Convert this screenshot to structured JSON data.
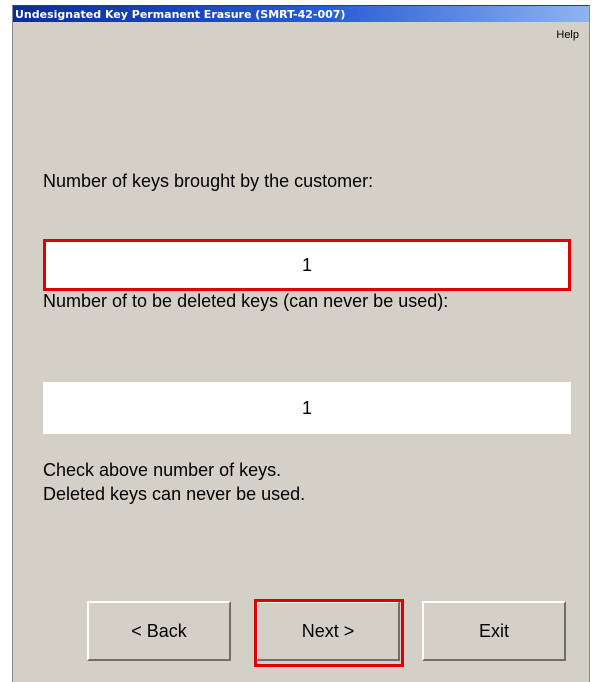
{
  "window": {
    "title": "Undesignated Key Permanent Erasure (SMRT-42-007)"
  },
  "menu": {
    "help_label": "Help"
  },
  "form": {
    "keys_brought_label": "Number of keys brought by the customer:",
    "keys_brought_value": "1",
    "keys_deleted_label": "Number of to be deleted keys (can never be used):",
    "keys_deleted_value": "1",
    "check_line_1": "Check above number of keys.",
    "check_line_2": "Deleted keys can never be used."
  },
  "buttons": {
    "back_label": "< Back",
    "next_label": "Next >",
    "exit_label": "Exit"
  },
  "colors": {
    "highlight": "#e10000",
    "titlebar": "#0b2c9a",
    "window_bg": "#d4d0c8"
  }
}
